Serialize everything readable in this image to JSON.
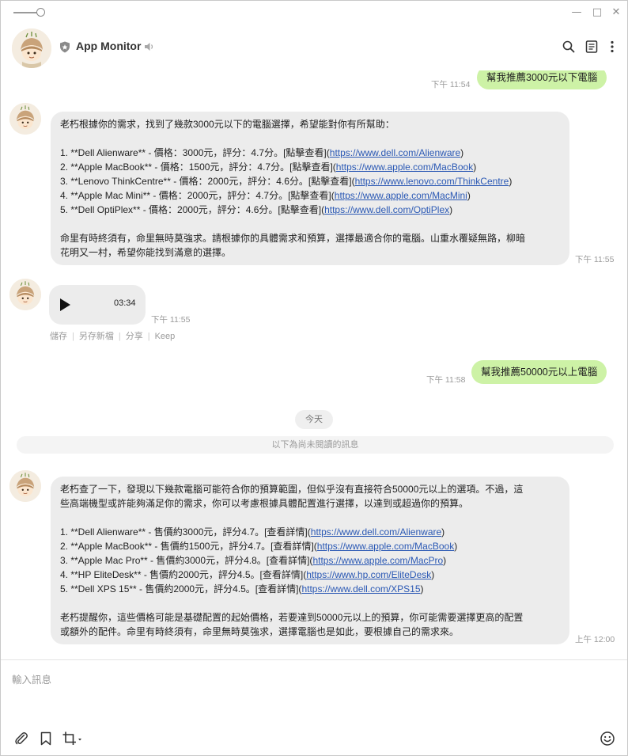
{
  "window": {
    "minimize_glyph": "—",
    "maximize_glyph": "□",
    "close_glyph": "✕"
  },
  "header": {
    "title": "App Monitor",
    "icons": [
      "shield-icon",
      "speaker-icon",
      "search-icon",
      "notes-icon",
      "more-icon"
    ]
  },
  "messages": [
    {
      "id": "m1",
      "direction": "out",
      "text": "幫我推薦3000元以下電腦",
      "time": "下午 11:54"
    },
    {
      "id": "m2",
      "direction": "in",
      "time": "下午 11:55",
      "lines": [
        {
          "text": "老朽根據你的需求，找到了幾款3000元以下的電腦選擇，希望能對你有所幫助："
        },
        {
          "text": ""
        },
        {
          "text": "1. **Dell Alienware** - 價格：3000元，評分：4.7分。[點擊查看](",
          "link": "https://www.dell.com/Alienware",
          "after": ")"
        },
        {
          "text": "2. **Apple MacBook** - 價格：1500元，評分：4.7分。[點擊查看](",
          "link": "https://www.apple.com/MacBook",
          "after": ")"
        },
        {
          "text": "3. **Lenovo ThinkCentre** - 價格：2000元，評分：4.6分。[點擊查看](",
          "link": "https://www.lenovo.com/ThinkCentre",
          "after": ")"
        },
        {
          "text": "4. **Apple Mac Mini** - 價格：2000元，評分：4.7分。[點擊查看](",
          "link": "https://www.apple.com/MacMini",
          "after": ")"
        },
        {
          "text": "5. **Dell OptiPlex** - 價格：2000元，評分：4.6分。[點擊查看](",
          "link": "https://www.dell.com/OptiPlex",
          "after": ")"
        },
        {
          "text": ""
        },
        {
          "text": "命里有時終須有，命里無時莫強求。請根據你的具體需求和預算，選擇最適合你的電腦。山重水覆疑無路，柳暗"
        },
        {
          "text": "花明又一村，希望你能找到滿意的選擇。"
        }
      ]
    },
    {
      "id": "m3",
      "direction": "in",
      "type": "voice",
      "duration": "03:34",
      "time": "下午 11:55",
      "actions": [
        "儲存",
        "另存新檔",
        "分享",
        "Keep"
      ]
    },
    {
      "id": "m4",
      "direction": "out",
      "text": "幫我推薦50000元以上電腦",
      "time": "下午 11:58"
    },
    {
      "id": "m5",
      "direction": "in",
      "time": "上午 12:00",
      "lines": [
        {
          "text": "老朽查了一下，發現以下幾款電腦可能符合你的預算範圍，但似乎沒有直接符合50000元以上的選項。不過，這"
        },
        {
          "text": "些高端機型或許能夠滿足你的需求，你可以考慮根據具體配置進行選擇，以達到或超過你的預算。"
        },
        {
          "text": ""
        },
        {
          "text": "1. **Dell Alienware** - 售價約3000元，評分4.7。[查看詳情](",
          "link": "https://www.dell.com/Alienware",
          "after": ")"
        },
        {
          "text": "2. **Apple MacBook** - 售價約1500元，評分4.7。[查看詳情](",
          "link": "https://www.apple.com/MacBook",
          "after": ")"
        },
        {
          "text": "3. **Apple Mac Pro** - 售價約3000元，評分4.8。[查看詳情](",
          "link": "https://www.apple.com/MacPro",
          "after": ")"
        },
        {
          "text": "4. **HP EliteDesk** - 售價約2000元，評分4.5。[查看詳情](",
          "link": "https://www.hp.com/EliteDesk",
          "after": ")"
        },
        {
          "text": "5. **Dell XPS 15** - 售價約2000元，評分4.5。[查看詳情](",
          "link": "https://www.dell.com/XPS15",
          "after": ")"
        },
        {
          "text": ""
        },
        {
          "text": "老朽提醒你，這些價格可能是基礎配置的起始價格，若要達到50000元以上的預算，你可能需要選擇更高的配置"
        },
        {
          "text": "或額外的配件。命里有時終須有，命里無時莫強求，選擇電腦也是如此，要根據自己的需求來。"
        }
      ]
    }
  ],
  "date_separator": "今天",
  "unread_notice": "以下為尚未閱讀的訊息",
  "composer": {
    "placeholder": "輸入訊息",
    "tools": [
      "paperclip-icon",
      "bookmark-icon",
      "crop-icon",
      "emoji-icon"
    ]
  },
  "colors": {
    "outgoing_bubble": "#cdf2a6",
    "incoming_bubble": "#ececec",
    "link": "#2a58b4",
    "timestamp": "#9a9a9a"
  }
}
